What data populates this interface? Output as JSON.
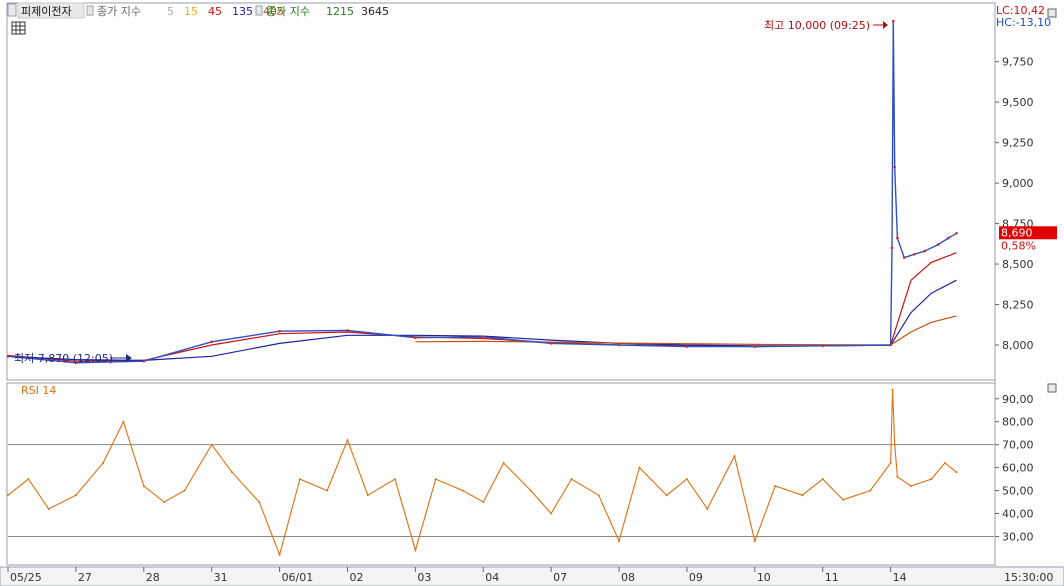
{
  "chart_data": {
    "type": "line",
    "title": "피제이전자",
    "legend": {
      "price_ma_label": "종가 지수",
      "price_ma_periods": [
        {
          "text": "5",
          "color": "#b0b0b0"
        },
        {
          "text": "15",
          "color": "#e8b020"
        },
        {
          "text": "45",
          "color": "#d01010"
        },
        {
          "text": "135",
          "color": "#2020a0"
        },
        {
          "text": "405",
          "color": "#c05010"
        }
      ],
      "volume_ma_label": "종가 지수",
      "volume_ma_periods": [
        {
          "text": "1215",
          "color": "#208020"
        },
        {
          "text": "3645",
          "color": "#222222"
        }
      ]
    },
    "price_axis": {
      "ticks": [
        "9,750",
        "9,500",
        "9,250",
        "9,000",
        "8,750",
        "8,500",
        "8,250",
        "8,000"
      ],
      "tick_values": [
        9750,
        9500,
        9250,
        9000,
        8750,
        8500,
        8250,
        8000
      ],
      "ylim": [
        7790,
        10100
      ],
      "lc_label": "LC:10,42",
      "hc_label": "HC:-13,10",
      "current_price": "8,690",
      "current_change": "0,58%",
      "current_value": 8690
    },
    "annotations": {
      "high_label": "최고 10,000 (09:25)",
      "high_value": 10000,
      "low_label": "최저 7,870 (12:05)",
      "low_value": 7870
    },
    "x_axis": {
      "dates": [
        "05/25",
        "27",
        "28",
        "31",
        "06/01",
        "02",
        "03",
        "04",
        "07",
        "08",
        "09",
        "10",
        "11",
        "14"
      ],
      "time_label": "15:30:00"
    },
    "price_series": {
      "name": "종가",
      "x": [
        0,
        1,
        2,
        3,
        4,
        5,
        6,
        7,
        8,
        9,
        10,
        11,
        12,
        13,
        13.02,
        13.04,
        13.06,
        13.1,
        13.2,
        13.35,
        13.5,
        13.7,
        13.85,
        13.97
      ],
      "y": [
        7930,
        7890,
        7900,
        8020,
        8085,
        8090,
        8045,
        8050,
        8010,
        8000,
        7990,
        7990,
        7995,
        8000,
        8600,
        10000,
        9100,
        8660,
        8540,
        8560,
        8580,
        8620,
        8660,
        8690
      ]
    },
    "ma_series": [
      {
        "period": "45",
        "color": "#d01010",
        "x": [
          0,
          1,
          2,
          3,
          4,
          5,
          6,
          7,
          8,
          9,
          10,
          11,
          12,
          13,
          13.3,
          13.6,
          13.97
        ],
        "y": [
          7935,
          7900,
          7905,
          8000,
          8070,
          8080,
          8050,
          8040,
          8015,
          8000,
          7995,
          7990,
          7995,
          8000,
          8400,
          8510,
          8570
        ]
      },
      {
        "period": "135",
        "color": "#2020a0",
        "x": [
          0,
          1,
          2,
          3,
          4,
          5,
          6,
          7,
          8,
          9,
          10,
          11,
          12,
          13,
          13.3,
          13.6,
          13.97
        ],
        "y": [
          7930,
          7910,
          7905,
          7930,
          8010,
          8060,
          8060,
          8055,
          8030,
          8010,
          8000,
          7995,
          7995,
          7998,
          8200,
          8320,
          8400
        ]
      },
      {
        "period": "405",
        "color": "#c05010",
        "x": [
          6,
          7,
          8,
          9,
          10,
          11,
          12,
          13,
          13.3,
          13.6,
          13.97
        ],
        "y": [
          8020,
          8022,
          8018,
          8012,
          8008,
          8004,
          8002,
          8000,
          8080,
          8140,
          8180
        ]
      }
    ],
    "rsi": {
      "label": "RSI 14",
      "ticks": [
        "90,00",
        "80,00",
        "70,00",
        "60,00",
        "50,00",
        "40,00",
        "30,00"
      ],
      "tick_values": [
        90,
        80,
        70,
        60,
        50,
        40,
        30
      ],
      "levels": [
        70,
        30
      ],
      "ylim": [
        18,
        96
      ],
      "x": [
        0,
        0.3,
        0.6,
        1,
        1.4,
        1.7,
        2,
        2.3,
        2.6,
        3,
        3.3,
        3.7,
        4,
        4.3,
        4.7,
        5,
        5.3,
        5.7,
        6,
        6.3,
        6.7,
        7,
        7.3,
        7.7,
        8,
        8.3,
        8.7,
        9,
        9.3,
        9.7,
        10,
        10.3,
        10.7,
        11,
        11.3,
        11.7,
        12,
        12.3,
        12.7,
        13,
        13.03,
        13.06,
        13.1,
        13.3,
        13.6,
        13.8,
        13.97
      ],
      "y": [
        48,
        55,
        42,
        48,
        62,
        80,
        52,
        45,
        50,
        70,
        58,
        45,
        22,
        55,
        50,
        72,
        48,
        55,
        24,
        55,
        50,
        45,
        62,
        50,
        40,
        55,
        48,
        28,
        60,
        48,
        55,
        42,
        65,
        28,
        52,
        48,
        55,
        46,
        50,
        62,
        94,
        70,
        56,
        52,
        55,
        62,
        58
      ]
    }
  }
}
